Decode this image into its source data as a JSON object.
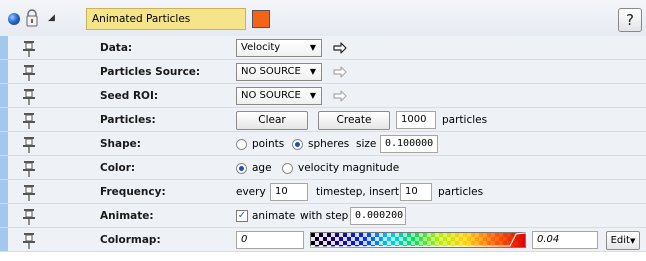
{
  "header": {
    "title": "Animated Particles",
    "color": "#f36419",
    "help_label": "?"
  },
  "rows": {
    "data": {
      "label": "Data:",
      "value": "Velocity"
    },
    "source": {
      "label": "Particles Source:",
      "value": "NO SOURCE"
    },
    "seed": {
      "label": "Seed ROI:",
      "value": "NO SOURCE"
    },
    "particles": {
      "label": "Particles:",
      "clear": "Clear",
      "create": "Create",
      "count": "1000",
      "unit": "particles"
    },
    "shape": {
      "label": "Shape:",
      "opt1": "points",
      "opt2": "spheres",
      "opt2_selected": true,
      "size_label": "size",
      "size_value": "0.100000"
    },
    "color": {
      "label": "Color:",
      "opt1": "age",
      "opt1_selected": true,
      "opt2": "velocity magnitude"
    },
    "frequency": {
      "label": "Frequency:",
      "every": "every",
      "every_value": "10",
      "mid": "timestep, insert",
      "insert_value": "10",
      "unit": "particles"
    },
    "animate": {
      "label": "Animate:",
      "checkbox_label": "animate",
      "checked": true,
      "step_label": "with step",
      "step_value": "0.000200"
    },
    "colormap": {
      "label": "Colormap:",
      "min": "0",
      "max": "0.04",
      "edit": "Edit"
    }
  },
  "icons": {
    "sphere": "blue-sphere-icon",
    "lock": "lock-icon",
    "pin": "pushpin-icon",
    "arrow": "right-arrow-icon",
    "disclosure": "collapse-triangle-icon"
  }
}
